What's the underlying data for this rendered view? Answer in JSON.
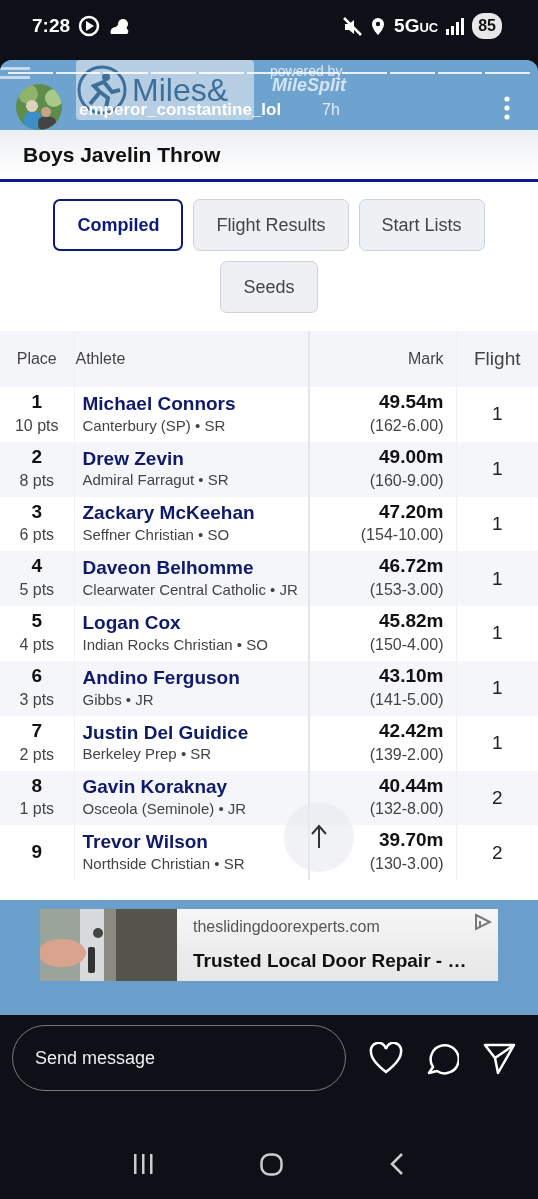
{
  "status_bar": {
    "time": "7:28",
    "network": "5G",
    "network_sub": "UC",
    "battery": "85"
  },
  "story": {
    "logo": "Miles&",
    "tagline": "powered by",
    "brand": "MileSplit",
    "username": "emperor_constantine_lol",
    "age": "7h"
  },
  "page": {
    "title": "Boys Javelin Throw",
    "tabs": [
      {
        "label": "Compiled",
        "selected": true
      },
      {
        "label": "Flight Results",
        "selected": false
      },
      {
        "label": "Start Lists",
        "selected": false
      },
      {
        "label": "Seeds",
        "selected": false
      }
    ],
    "table": {
      "columns": [
        "Place",
        "Athlete",
        "Mark",
        "Flight"
      ],
      "rows": [
        {
          "place": "1",
          "points": "10 pts",
          "athlete": "Michael Connors",
          "school": "Canterbury (SP) • SR",
          "mark": "49.54m",
          "mark_ft": "(162-6.00)",
          "flight": "1"
        },
        {
          "place": "2",
          "points": "8 pts",
          "athlete": "Drew Zevin",
          "school": "Admiral Farragut • SR",
          "mark": "49.00m",
          "mark_ft": "(160-9.00)",
          "flight": "1"
        },
        {
          "place": "3",
          "points": "6 pts",
          "athlete": "Zackary McKeehan",
          "school": "Seffner Christian • SO",
          "mark": "47.20m",
          "mark_ft": "(154-10.00)",
          "flight": "1"
        },
        {
          "place": "4",
          "points": "5 pts",
          "athlete": "Daveon Belhomme",
          "school": "Clearwater Central Catholic • JR",
          "mark": "46.72m",
          "mark_ft": "(153-3.00)",
          "flight": "1"
        },
        {
          "place": "5",
          "points": "4 pts",
          "athlete": "Logan Cox",
          "school": "Indian Rocks Christian • SO",
          "mark": "45.82m",
          "mark_ft": "(150-4.00)",
          "flight": "1"
        },
        {
          "place": "6",
          "points": "3 pts",
          "athlete": "Andino Ferguson",
          "school": "Gibbs • JR",
          "mark": "43.10m",
          "mark_ft": "(141-5.00)",
          "flight": "1"
        },
        {
          "place": "7",
          "points": "2 pts",
          "athlete": "Justin Del Guidice",
          "school": "Berkeley Prep • SR",
          "mark": "42.42m",
          "mark_ft": "(139-2.00)",
          "flight": "1"
        },
        {
          "place": "8",
          "points": "1 pts",
          "athlete": "Gavin Koraknay",
          "school": "Osceola (Seminole) • JR",
          "mark": "40.44m",
          "mark_ft": "(132-8.00)",
          "flight": "2"
        },
        {
          "place": "9",
          "athlete": "Trevor Wilson",
          "school": "Northside Christian • SR",
          "mark": "39.70m",
          "mark_ft": "(130-3.00)",
          "flight": "2"
        }
      ]
    }
  },
  "ad": {
    "domain": "theslidingdoorexperts.com",
    "headline": "Trusted Local Door Repair - …"
  },
  "reply": {
    "placeholder": "Send message"
  }
}
